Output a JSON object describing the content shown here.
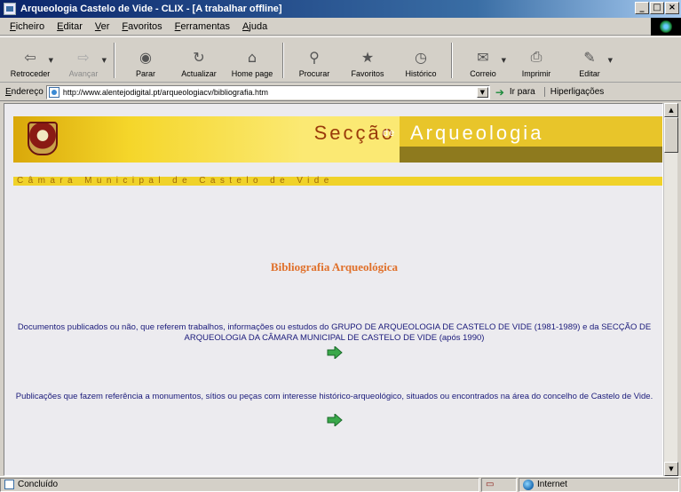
{
  "window": {
    "title": "Arqueologia Castelo de Vide - CLIX - [A trabalhar offline]",
    "buttons": {
      "minimize": "_",
      "maximize": "□",
      "close": "×"
    }
  },
  "menubar": {
    "items": [
      "Ficheiro",
      "Editar",
      "Ver",
      "Favoritos",
      "Ferramentas",
      "Ajuda"
    ]
  },
  "toolbar": {
    "buttons": [
      {
        "label": "Retroceder",
        "icon": "back-arrow-icon",
        "glyph": "⇦",
        "disabled": false,
        "dropdown": true
      },
      {
        "label": "Avançar",
        "icon": "forward-arrow-icon",
        "glyph": "⇨",
        "disabled": true,
        "dropdown": true
      },
      {
        "label": "Parar",
        "icon": "stop-icon",
        "glyph": "◉",
        "disabled": false,
        "dropdown": false
      },
      {
        "label": "Actualizar",
        "icon": "refresh-icon",
        "glyph": "↻",
        "disabled": false,
        "dropdown": false
      },
      {
        "label": "Home page",
        "icon": "home-icon",
        "glyph": "⌂",
        "disabled": false,
        "dropdown": false
      },
      {
        "label": "Procurar",
        "icon": "search-icon",
        "glyph": "⚲",
        "disabled": false,
        "dropdown": false
      },
      {
        "label": "Favoritos",
        "icon": "favorites-icon",
        "glyph": "★",
        "disabled": false,
        "dropdown": false
      },
      {
        "label": "Histórico",
        "icon": "history-icon",
        "glyph": "◷",
        "disabled": false,
        "dropdown": false
      },
      {
        "label": "Correio",
        "icon": "mail-icon",
        "glyph": "✉",
        "disabled": false,
        "dropdown": true
      },
      {
        "label": "Imprimir",
        "icon": "print-icon",
        "glyph": "⎙",
        "disabled": false,
        "dropdown": false
      },
      {
        "label": "Editar",
        "icon": "edit-icon",
        "glyph": "✎",
        "disabled": false,
        "dropdown": true
      }
    ]
  },
  "addressbar": {
    "label": "Endereço",
    "url": "http://www.alentejodigital.pt/arqueologiacv/bibliografia.htm",
    "go_label": "Ir para",
    "links_label": "Hiperligações"
  },
  "page": {
    "header": {
      "title_left": "Secção",
      "title_connector": "de",
      "title_right": "Arqueologia",
      "subtitle": "Câmara Municipal de Castelo de Vide"
    },
    "section_title": "Bibliografia Arqueológica",
    "paragraphs": [
      "Documentos publicados ou não, que referem trabalhos, informações ou estudos do GRUPO DE ARQUEOLOGIA DE CASTELO DE VIDE (1981-1989) e da SECÇÃO DE ARQUEOLOGIA DA CÂMARA MUNICIPAL DE CASTELO DE VIDE (após 1990)",
      "Publicações que fazem referência a monumentos, sítios ou peças com interesse histórico-arqueológico, situados ou encontrados na área do concelho de Castelo de Vide."
    ]
  },
  "statusbar": {
    "status": "Concluído",
    "zone": "Internet"
  },
  "colors": {
    "header_gold": "#f5d62a",
    "header_dark": "#8e7a1e",
    "title_text": "#e0702a",
    "paragraph_text": "#1a1a7a",
    "arrow_green": "#3aa84a"
  }
}
